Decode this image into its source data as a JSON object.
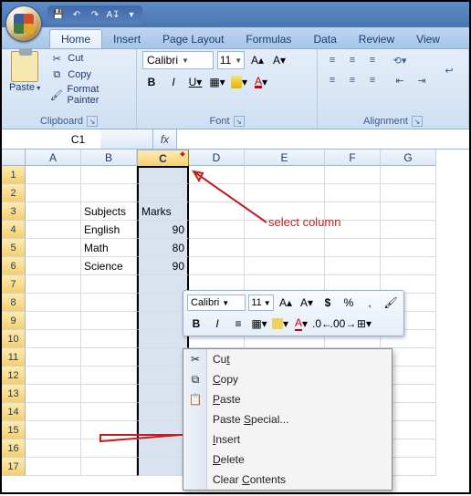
{
  "qat": {
    "save": "💾",
    "undo": "↶",
    "redo": "↷",
    "sort": "A↧",
    "more": "▾"
  },
  "tabs": [
    "Home",
    "Insert",
    "Page Layout",
    "Formulas",
    "Data",
    "Review",
    "View"
  ],
  "active_tab": "Home",
  "ribbon": {
    "clipboard": {
      "label": "Clipboard",
      "paste": "Paste",
      "cut": "Cut",
      "copy": "Copy",
      "format_painter": "Format Painter"
    },
    "font": {
      "label": "Font",
      "name": "Calibri",
      "size": "11"
    },
    "alignment": {
      "label": "Alignment"
    }
  },
  "namebox": "C1",
  "formula": "",
  "columns": [
    "A",
    "B",
    "C",
    "D",
    "E",
    "F",
    "G"
  ],
  "selected_column": "C",
  "rows": [
    1,
    2,
    3,
    4,
    5,
    6,
    7,
    8,
    9,
    10,
    11,
    12,
    13,
    14,
    15,
    16,
    17
  ],
  "data": {
    "B3": "Subjects",
    "C3": "Marks",
    "B4": "English",
    "C4": "90",
    "B5": "Math",
    "C5": "80",
    "B6": "Science",
    "C6": "90"
  },
  "mini": {
    "font": "Calibri",
    "size": "11"
  },
  "ctx": {
    "cut": "Cut",
    "copy": "Copy",
    "paste": "Paste",
    "paste_special": "Paste Special...",
    "insert": "Insert",
    "delete": "Delete",
    "clear": "Clear Contents"
  },
  "anno": {
    "select_column": "select column",
    "delete_arrow": ""
  }
}
